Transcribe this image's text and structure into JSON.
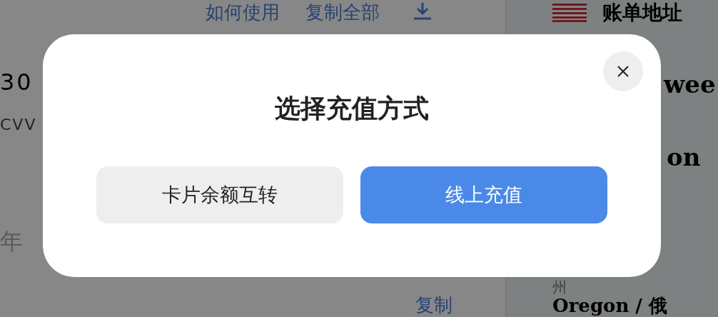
{
  "background_page": {
    "toolbar_links": [
      "如何使用",
      "复制全部"
    ],
    "card_number_fragment": "30",
    "cvv_label": "CVV",
    "year_label": "年",
    "copy_link": "复制",
    "billing_address": {
      "title": "账单地址",
      "street_fragment": "wee",
      "city_fragment": "on",
      "state_label": "州",
      "state_value": "Oregon / 俄"
    }
  },
  "dialog": {
    "title": "选择充值方式",
    "options": [
      {
        "label": "卡片余额互转",
        "primary": false
      },
      {
        "label": "线上充值",
        "primary": true
      }
    ]
  }
}
